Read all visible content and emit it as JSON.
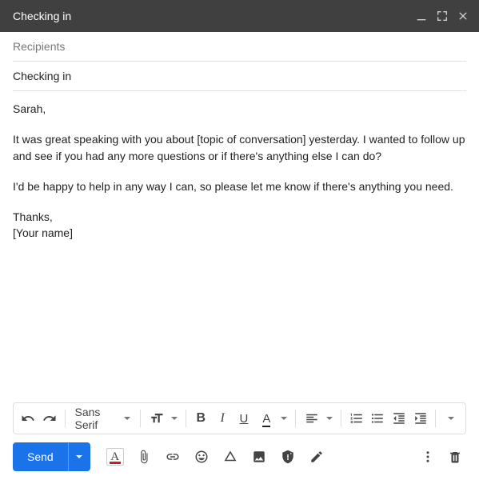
{
  "header": {
    "title": "Checking in"
  },
  "fields": {
    "recipients_placeholder": "Recipients",
    "subject": "Checking in"
  },
  "body": {
    "p1": "Sarah,",
    "p2": "It was great speaking with you about [topic of conversation] yesterday. I wanted to follow up and see if you had any more questions or if there's anything else I can do?",
    "p3": "I'd be happy to help in any way I can, so please let me know if there's anything you need.",
    "p4": "Thanks,",
    "p5": "[Your name]"
  },
  "toolbar": {
    "font_family": "Sans Serif",
    "bold_glyph": "B",
    "italic_glyph": "I",
    "underline_glyph": "U",
    "textcolor_glyph": "A"
  },
  "bottom": {
    "send_label": "Send",
    "format_glyph": "A"
  }
}
